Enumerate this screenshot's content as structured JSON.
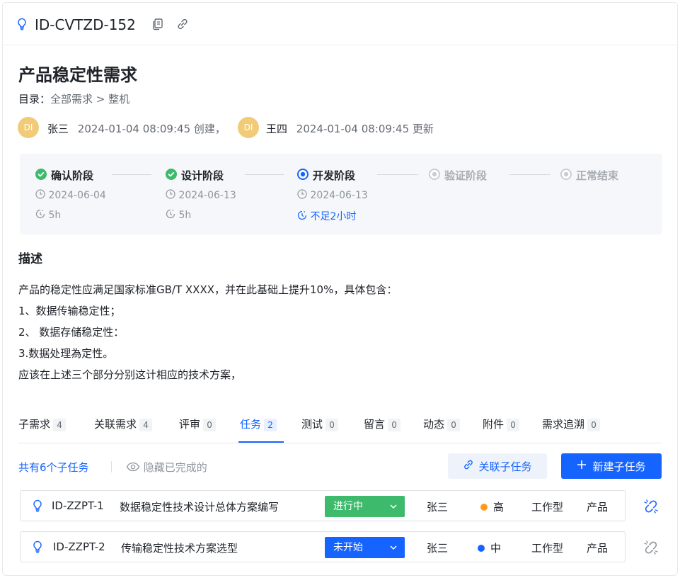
{
  "header": {
    "id": "ID-CVTZD-152",
    "icon": "lightbulb-icon",
    "actions": [
      "copy-icon",
      "link-icon"
    ]
  },
  "title": "产品稳定性需求",
  "catalog": {
    "label": "目录：",
    "path": "全部需求 > 整机"
  },
  "creator": {
    "avatar": "DI",
    "name": "张三",
    "time": "2024-01-04 08:09:45",
    "action": "创建，"
  },
  "updater": {
    "avatar": "DI",
    "name": "王四",
    "time": "2024-01-04 08:09:45",
    "action": "更新"
  },
  "stages": [
    {
      "name": "确认阶段",
      "state": "done",
      "date": "2024-06-04",
      "duration": "5h"
    },
    {
      "name": "设计阶段",
      "state": "done",
      "date": "2024-06-13",
      "duration": "5h"
    },
    {
      "name": "开发阶段",
      "state": "current",
      "date": "2024-06-13",
      "duration": "不足2小时"
    },
    {
      "name": "验证阶段",
      "state": "pending"
    },
    {
      "name": "正常结束",
      "state": "pending"
    }
  ],
  "description": {
    "heading": "描述",
    "lines": [
      "产品的稳定性应满足国家标准GB/T XXXX，并在此基础上提升10%，具体包含：",
      "1、数据传输稳定性；",
      "2、 数据存储稳定性：",
      "3.数据处理為定性。",
      "应该在上述三个部分分别这计相应的技术方案，"
    ]
  },
  "tabs": [
    {
      "label": "子需求",
      "count": "4"
    },
    {
      "label": "关联需求",
      "count": "4"
    },
    {
      "label": "评审",
      "count": "0"
    },
    {
      "label": "任务",
      "count": "2",
      "active": true
    },
    {
      "label": "测试",
      "count": "0"
    },
    {
      "label": "留言",
      "count": "0"
    },
    {
      "label": "动态",
      "count": "0"
    },
    {
      "label": "附件",
      "count": "0"
    },
    {
      "label": "需求追溯",
      "count": "0"
    }
  ],
  "toolbar": {
    "total": "共有6个子任务",
    "hide_completed": "隐藏已完成的",
    "link_task": "关联子任务",
    "new_task": "新建子任务"
  },
  "tasks": [
    {
      "id": "ID-ZZPT-1",
      "title": "数据稳定性技术设计总体方案编写",
      "status": "进行中",
      "status_color": "#3dba6b",
      "owner": "张三",
      "priority": "高",
      "priority_color": "#ff9d1a",
      "type": "工作型",
      "category": "产品"
    },
    {
      "id": "ID-ZZPT-2",
      "title": "传输稳定性技术方案选型",
      "status": "未开始",
      "status_color": "#1664ff",
      "owner": "张三",
      "priority": "中",
      "priority_color": "#1664ff",
      "type": "工作型",
      "category": "产品"
    }
  ],
  "colors": {
    "accent": "#1664ff",
    "success": "#3dba6b",
    "muted": "#8f959e"
  }
}
